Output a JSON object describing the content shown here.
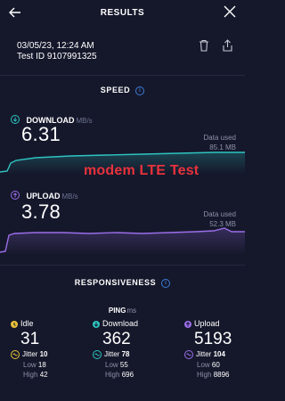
{
  "header": {
    "title": "RESULTS"
  },
  "meta": {
    "date": "03/05/23, 12:24 AM",
    "test_id": "Test ID 9107991325"
  },
  "speed": {
    "title": "SPEED",
    "download": {
      "label": "DOWNLOAD",
      "unit": "MB/s",
      "value": "6.31",
      "data_used_label": "Data used",
      "data_used": "85.1 MB",
      "color": "#2ec4c1"
    },
    "upload": {
      "label": "UPLOAD",
      "unit": "MB/s",
      "value": "3.78",
      "data_used_label": "Data used",
      "data_used": "52.3 MB",
      "color": "#9b6ee8"
    }
  },
  "annotation": {
    "text": "modem LTE Test",
    "color": "#e8323c"
  },
  "responsiveness": {
    "title": "RESPONSIVENESS",
    "ping_label": "PING",
    "ping_unit": "ms",
    "columns": [
      {
        "name": "Idle",
        "value": "31",
        "jitter_label": "Jitter",
        "jitter": "10",
        "low_label": "Low",
        "low": "18",
        "high_label": "High",
        "high": "42",
        "color": "#e8c23a"
      },
      {
        "name": "Download",
        "value": "362",
        "jitter_label": "Jitter",
        "jitter": "78",
        "low_label": "Low",
        "low": "55",
        "high_label": "High",
        "high": "696",
        "color": "#2ec4c1"
      },
      {
        "name": "Upload",
        "value": "5193",
        "jitter_label": "Jitter",
        "jitter": "104",
        "low_label": "Low",
        "low": "60",
        "high_label": "High",
        "high": "8896",
        "color": "#9b6ee8"
      }
    ]
  },
  "icons": {
    "back": "arrow-left-icon",
    "close": "close-icon",
    "delete": "trash-icon",
    "share": "share-icon",
    "info": "info-icon"
  }
}
